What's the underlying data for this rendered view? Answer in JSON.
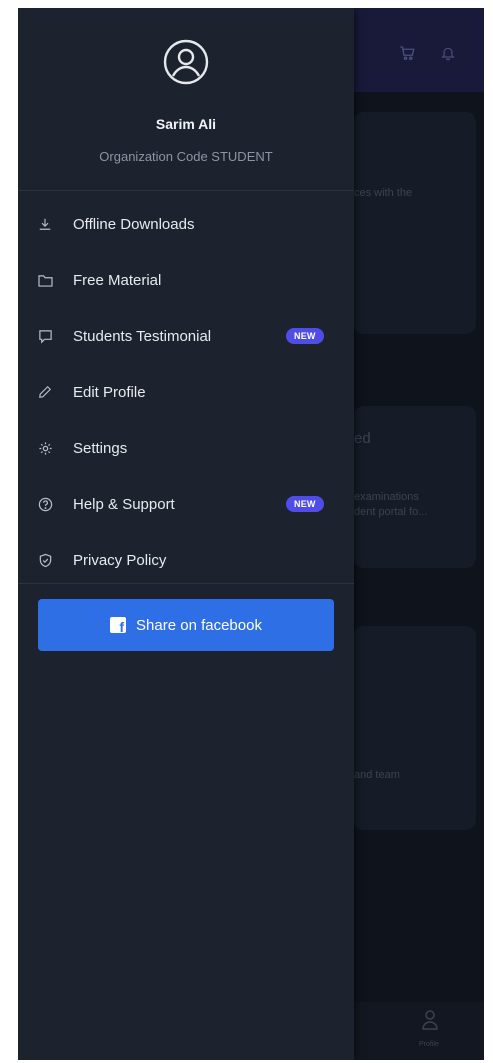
{
  "drawer": {
    "profile": {
      "name": "Sarim Ali",
      "org_code": "Organization Code STUDENT"
    },
    "menu": [
      {
        "label": "Offline Downloads",
        "icon": "download-icon"
      },
      {
        "label": "Free Material",
        "icon": "folder-icon"
      },
      {
        "label": "Students Testimonial",
        "icon": "chat-bubble-icon",
        "badge": "NEW"
      },
      {
        "label": "Edit Profile",
        "icon": "pencil-icon"
      },
      {
        "label": "Settings",
        "icon": "gear-icon"
      },
      {
        "label": "Help & Support",
        "icon": "help-circle-icon",
        "badge": "NEW"
      },
      {
        "label": "Privacy Policy",
        "icon": "shield-check-icon"
      }
    ],
    "share_button": {
      "label": "Share on facebook",
      "icon": "facebook-icon"
    }
  },
  "background": {
    "card1_text": "ces with the",
    "card2_heading": "ed",
    "card2_line1": "examinations",
    "card2_line2": "dent portal fo...",
    "card3_text": "and team",
    "nav_profile_label": "Profile"
  },
  "colors": {
    "drawer_bg": "#1c232f",
    "header_bg": "#191a3a",
    "badge": "#4f4de5",
    "facebook_blue": "#2f6fe6"
  }
}
